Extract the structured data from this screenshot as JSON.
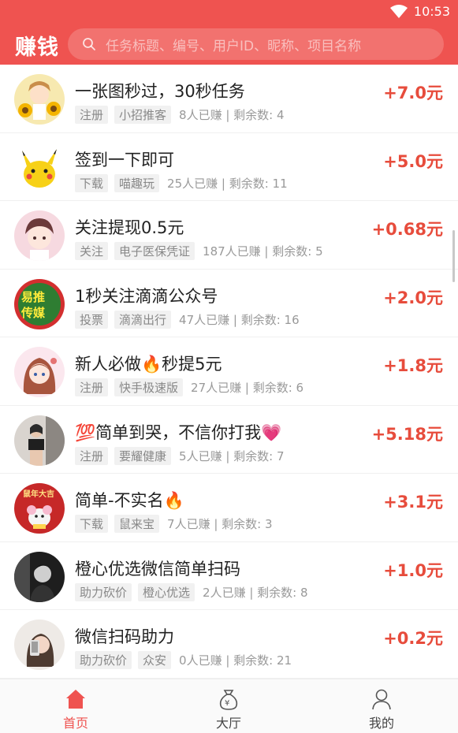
{
  "status_bar": {
    "time": "10:53"
  },
  "header": {
    "brand": "赚钱",
    "search_placeholder": "任务标题、编号、用户ID、昵称、项目名称"
  },
  "tasks": [
    {
      "title": "一张图秒过，30秒任务",
      "tags": [
        "注册",
        "小招推客"
      ],
      "stats": "8人已赚 | 剩余数: 4",
      "reward": "+7.0元",
      "avatar_icon": "sunflower-girl-avatar"
    },
    {
      "title": "签到一下即可",
      "tags": [
        "下载",
        "喵趣玩"
      ],
      "stats": "25人已赚 | 剩余数: 11",
      "reward": "+5.0元",
      "avatar_icon": "pikachu-avatar"
    },
    {
      "title": "关注提现0.5元",
      "tags": [
        "关注",
        "电子医保凭证"
      ],
      "stats": "187人已赚 | 剩余数: 5",
      "reward": "+0.68元",
      "avatar_icon": "anime-boy-avatar"
    },
    {
      "title": "1秒关注滴滴公众号",
      "tags": [
        "投票",
        "滴滴出行"
      ],
      "stats": "47人已赚 | 剩余数: 16",
      "reward": "+2.0元",
      "avatar_icon": "yituichuanmei-logo-avatar",
      "avatar_text": "易推传媒"
    },
    {
      "title": "新人必做🔥秒提5元",
      "tags": [
        "注册",
        "快手极速版"
      ],
      "stats": "27人已赚 | 剩余数: 6",
      "reward": "+1.8元",
      "avatar_icon": "anime-girl-avatar"
    },
    {
      "title": "💯简单到哭，不信你打我💗",
      "tags": [
        "注册",
        "要耀健康"
      ],
      "stats": "5人已赚 | 剩余数: 7",
      "reward": "+5.18元",
      "avatar_icon": "mirror-selfie-avatar"
    },
    {
      "title": "简单-不实名🔥",
      "tags": [
        "下载",
        "鼠来宝"
      ],
      "stats": "7人已赚 | 剩余数: 3",
      "reward": "+3.1元",
      "avatar_icon": "rat-year-avatar",
      "avatar_text": "鼠年大吉"
    },
    {
      "title": "橙心优选微信简单扫码",
      "tags": [
        "助力砍价",
        "橙心优选"
      ],
      "stats": "2人已赚 | 剩余数: 8",
      "reward": "+1.0元",
      "avatar_icon": "dark-portrait-avatar"
    },
    {
      "title": "微信扫码助力",
      "tags": [
        "助力砍价",
        "众安"
      ],
      "stats": "0人已赚 | 剩余数: 21",
      "reward": "+0.2元",
      "avatar_icon": "phone-selfie-avatar"
    }
  ],
  "tabbar": {
    "items": [
      {
        "label": "首页",
        "icon": "home-icon",
        "active": true
      },
      {
        "label": "大厅",
        "icon": "money-bag-icon",
        "active": false
      },
      {
        "label": "我的",
        "icon": "user-icon",
        "active": false
      }
    ]
  },
  "colors": {
    "brand": "#ef5350",
    "reward": "#e74c3c"
  }
}
